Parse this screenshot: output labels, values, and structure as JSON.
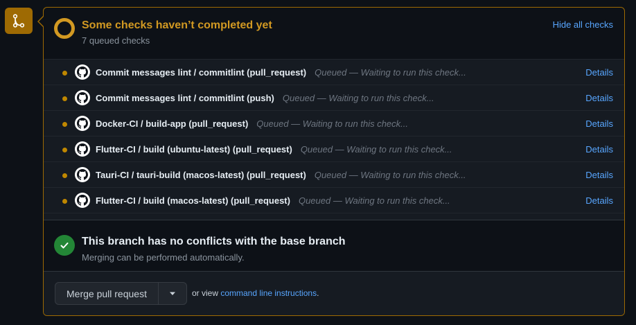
{
  "checks": {
    "title": "Some checks haven’t completed yet",
    "subtitle": "7 queued checks",
    "hide_label": "Hide all checks",
    "details_label": "Details",
    "items": [
      {
        "name": "Commit messages lint / commitlint (pull_request)",
        "status": "Queued — Waiting to run this check..."
      },
      {
        "name": "Commit messages lint / commitlint (push)",
        "status": "Queued — Waiting to run this check..."
      },
      {
        "name": "Docker-CI / build-app (pull_request)",
        "status": "Queued — Waiting to run this check..."
      },
      {
        "name": "Flutter-CI / build (ubuntu-latest) (pull_request)",
        "status": "Queued — Waiting to run this check..."
      },
      {
        "name": "Tauri-CI / tauri-build (macos-latest) (pull_request)",
        "status": "Queued — Waiting to run this check..."
      },
      {
        "name": "Flutter-CI / build (macos-latest) (pull_request)",
        "status": "Queued — Waiting to run this check..."
      }
    ]
  },
  "conflicts": {
    "title": "This branch has no conflicts with the base branch",
    "subtitle": "Merging can be performed automatically."
  },
  "merge": {
    "button_label": "Merge pull request",
    "or_view": "or view ",
    "link_label": "command line instructions",
    "period": "."
  },
  "colors": {
    "pending": "#d29922",
    "success": "#238636",
    "link": "#58a6ff"
  },
  "icons": {
    "merge": "git-merge-icon",
    "pending": "pending-ring-icon",
    "avatar": "github-icon",
    "success": "check-icon",
    "caret": "triangle-down-icon"
  }
}
